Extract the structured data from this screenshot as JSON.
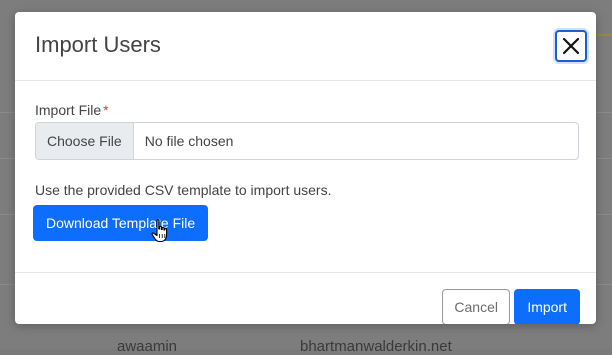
{
  "background": {
    "row_left": "awaamin",
    "row_right": "bhartmanwalderkin.net"
  },
  "modal": {
    "title": "Import Users",
    "close_icon": "close-icon",
    "import_file": {
      "label": "Import File",
      "required_marker": "*",
      "choose_button": "Choose File",
      "status": "No file chosen"
    },
    "help_text": "Use the provided CSV template to import users.",
    "download_button": "Download Template File",
    "footer": {
      "cancel_label": "Cancel",
      "import_label": "Import"
    }
  },
  "colors": {
    "primary": "#0d6efd",
    "required": "#dc3545",
    "focus_ring": "#1d5fd1"
  }
}
